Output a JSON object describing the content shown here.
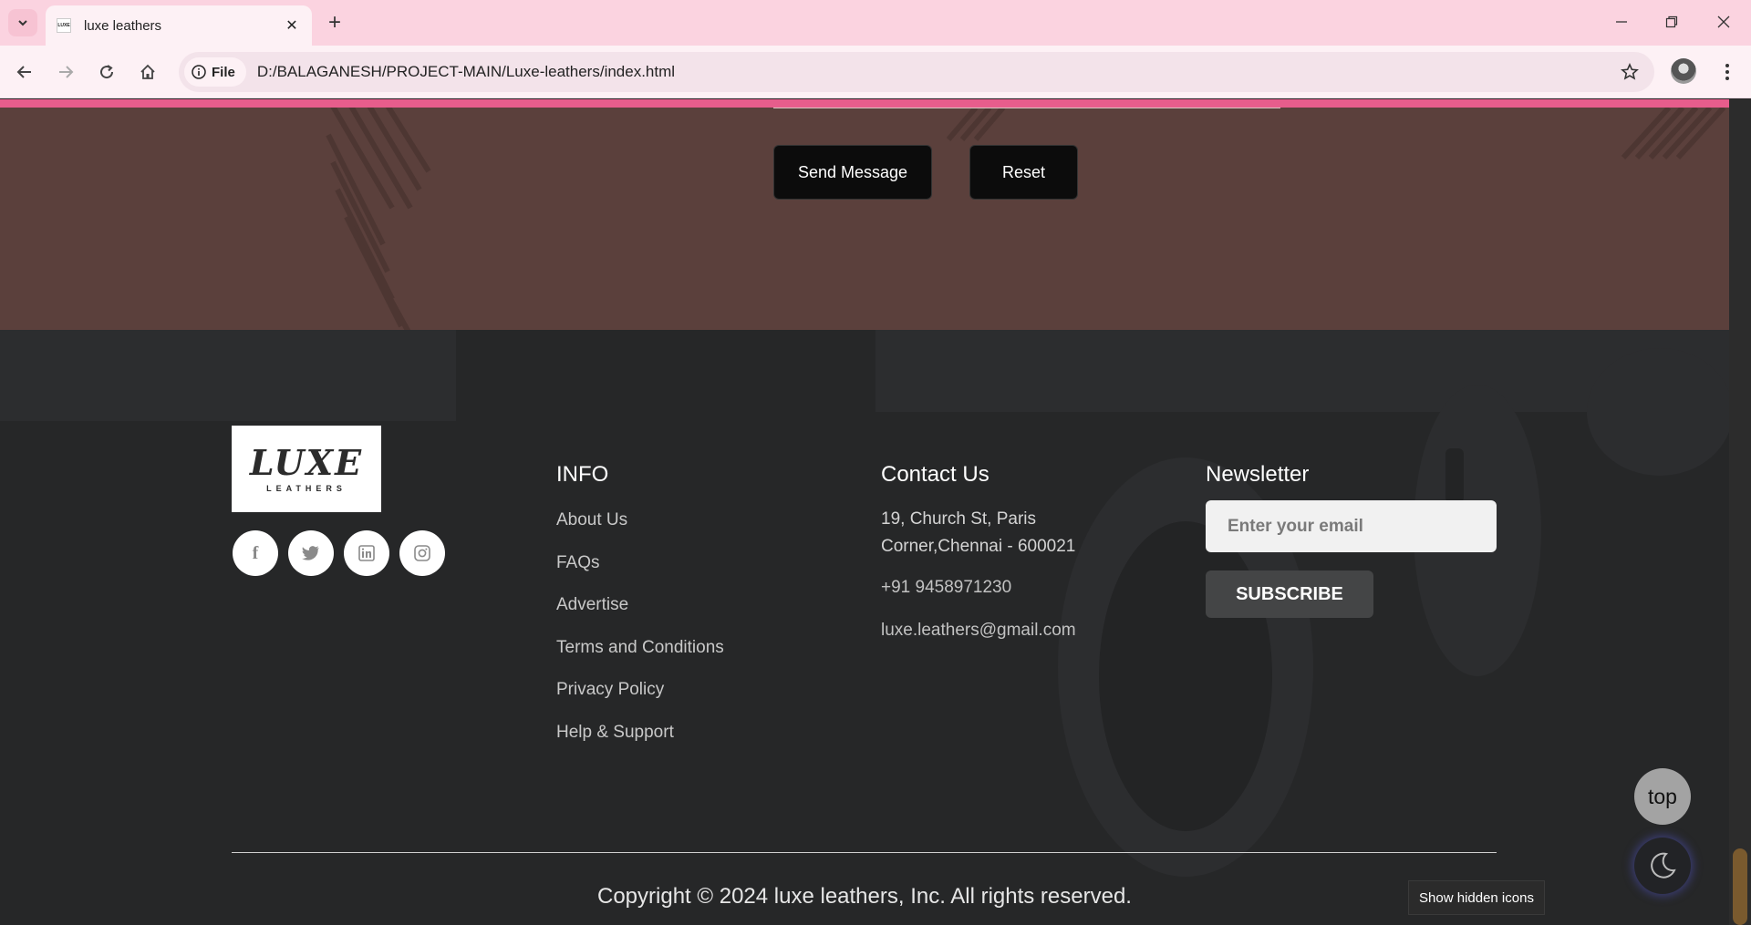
{
  "browser": {
    "tab_title": "luxe leathers",
    "favicon_text": "LUXE",
    "site_chip": "File",
    "url": "D:/BALAGANESH/PROJECT-MAIN/Luxe-leathers/index.html"
  },
  "contact_form": {
    "send_label": "Send Message",
    "reset_label": "Reset"
  },
  "footer": {
    "logo": {
      "main": "LUXE",
      "sub": "LEATHERS"
    },
    "social_icons": [
      "facebook-icon",
      "twitter-icon",
      "linkedin-icon",
      "instagram-icon"
    ],
    "info": {
      "title": "INFO",
      "links": [
        "About Us",
        "FAQs",
        "Advertise",
        "Terms and Conditions",
        "Privacy Policy",
        "Help & Support"
      ]
    },
    "contact": {
      "title": "Contact Us",
      "address_line1": "19, Church St, Paris",
      "address_line2": "Corner,Chennai - 600021",
      "phone": "+91 9458971230",
      "email": "luxe.leathers@gmail.com"
    },
    "newsletter": {
      "title": "Newsletter",
      "placeholder": "Enter your email",
      "button": "SUBSCRIBE"
    },
    "copyright": "Copyright © 2024 luxe leathers, Inc. All rights reserved."
  },
  "floating": {
    "top_label": "top",
    "tooltip": "Show hidden icons"
  },
  "colors": {
    "tabbar": "#fbd3e0",
    "accent_pink": "#e75d8c",
    "contact_bg": "#5b403c",
    "footer_bg": "#262728"
  }
}
